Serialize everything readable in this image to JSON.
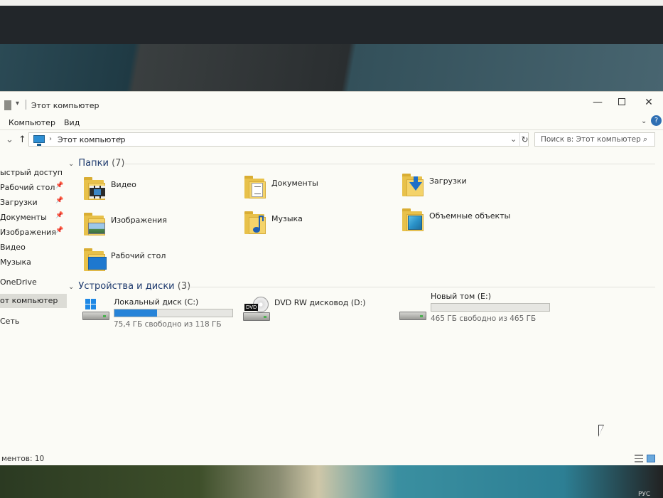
{
  "window": {
    "title": "Этот компьютер",
    "pin_glyph": "▾",
    "controls": {
      "minimize": "—",
      "maximize": "",
      "close": "✕"
    }
  },
  "ribbon": {
    "tabs": [
      "Компьютер",
      "Вид"
    ],
    "expand_glyph": "⌄",
    "help_glyph": "?"
  },
  "address_bar": {
    "back_glyph": "⌄",
    "up_glyph": "↑",
    "chevron": "›",
    "crumb": "Этот компьютер",
    "dropdown_glyph": "⌄",
    "refresh_glyph": "↻"
  },
  "search": {
    "placeholder": "Поиск в: Этот компьютер",
    "icon": "search-icon",
    "glyph": "⌕"
  },
  "sidebar": {
    "pin_glyph": "📌",
    "items": [
      {
        "label": "ыстрый доступ",
        "pinned": false
      },
      {
        "label": "Рабочий стол",
        "pinned": true
      },
      {
        "label": "Загрузки",
        "pinned": true
      },
      {
        "label": "Документы",
        "pinned": true
      },
      {
        "label": "Изображения",
        "pinned": true
      },
      {
        "label": "Видео",
        "pinned": false
      },
      {
        "label": "Музыка",
        "pinned": false
      },
      {
        "label": "OneDrive",
        "pinned": false
      },
      {
        "label": "от компьютер",
        "pinned": false,
        "active": true
      },
      {
        "label": "Сеть",
        "pinned": false
      }
    ]
  },
  "folders_group": {
    "chevron": "⌄",
    "title": "Папки",
    "count": "(7)",
    "items": [
      {
        "label": "Видео",
        "icon": "video-folder-icon"
      },
      {
        "label": "Документы",
        "icon": "documents-folder-icon"
      },
      {
        "label": "Загрузки",
        "icon": "downloads-folder-icon"
      },
      {
        "label": "Изображения",
        "icon": "pictures-folder-icon"
      },
      {
        "label": "Музыка",
        "icon": "music-folder-icon"
      },
      {
        "label": "Объемные объекты",
        "icon": "3d-objects-folder-icon"
      },
      {
        "label": "Рабочий стол",
        "icon": "desktop-folder-icon"
      }
    ]
  },
  "drives_group": {
    "chevron": "⌄",
    "title": "Устройства и диски",
    "count": "(3)",
    "items": [
      {
        "label": "Локальный диск (C:)",
        "free_text": "75,4 ГБ свободно из 118 ГБ",
        "used_fraction": 0.36,
        "icon": "system-drive-icon"
      },
      {
        "label": "DVD RW дисковод (D:)",
        "icon": "dvd-drive-icon",
        "dvd_badge": "DVD"
      },
      {
        "label": "Новый том (E:)",
        "free_text": "465 ГБ свободно из 465 ГБ",
        "used_fraction": 0.0,
        "icon": "hard-drive-icon"
      }
    ]
  },
  "status_bar": {
    "text": "ментов: 10"
  },
  "taskbar": {
    "lang": "РУС"
  },
  "colors": {
    "accent": "#2683d8",
    "folder": "#e8c14a",
    "group_heading": "#1e3a6e"
  }
}
